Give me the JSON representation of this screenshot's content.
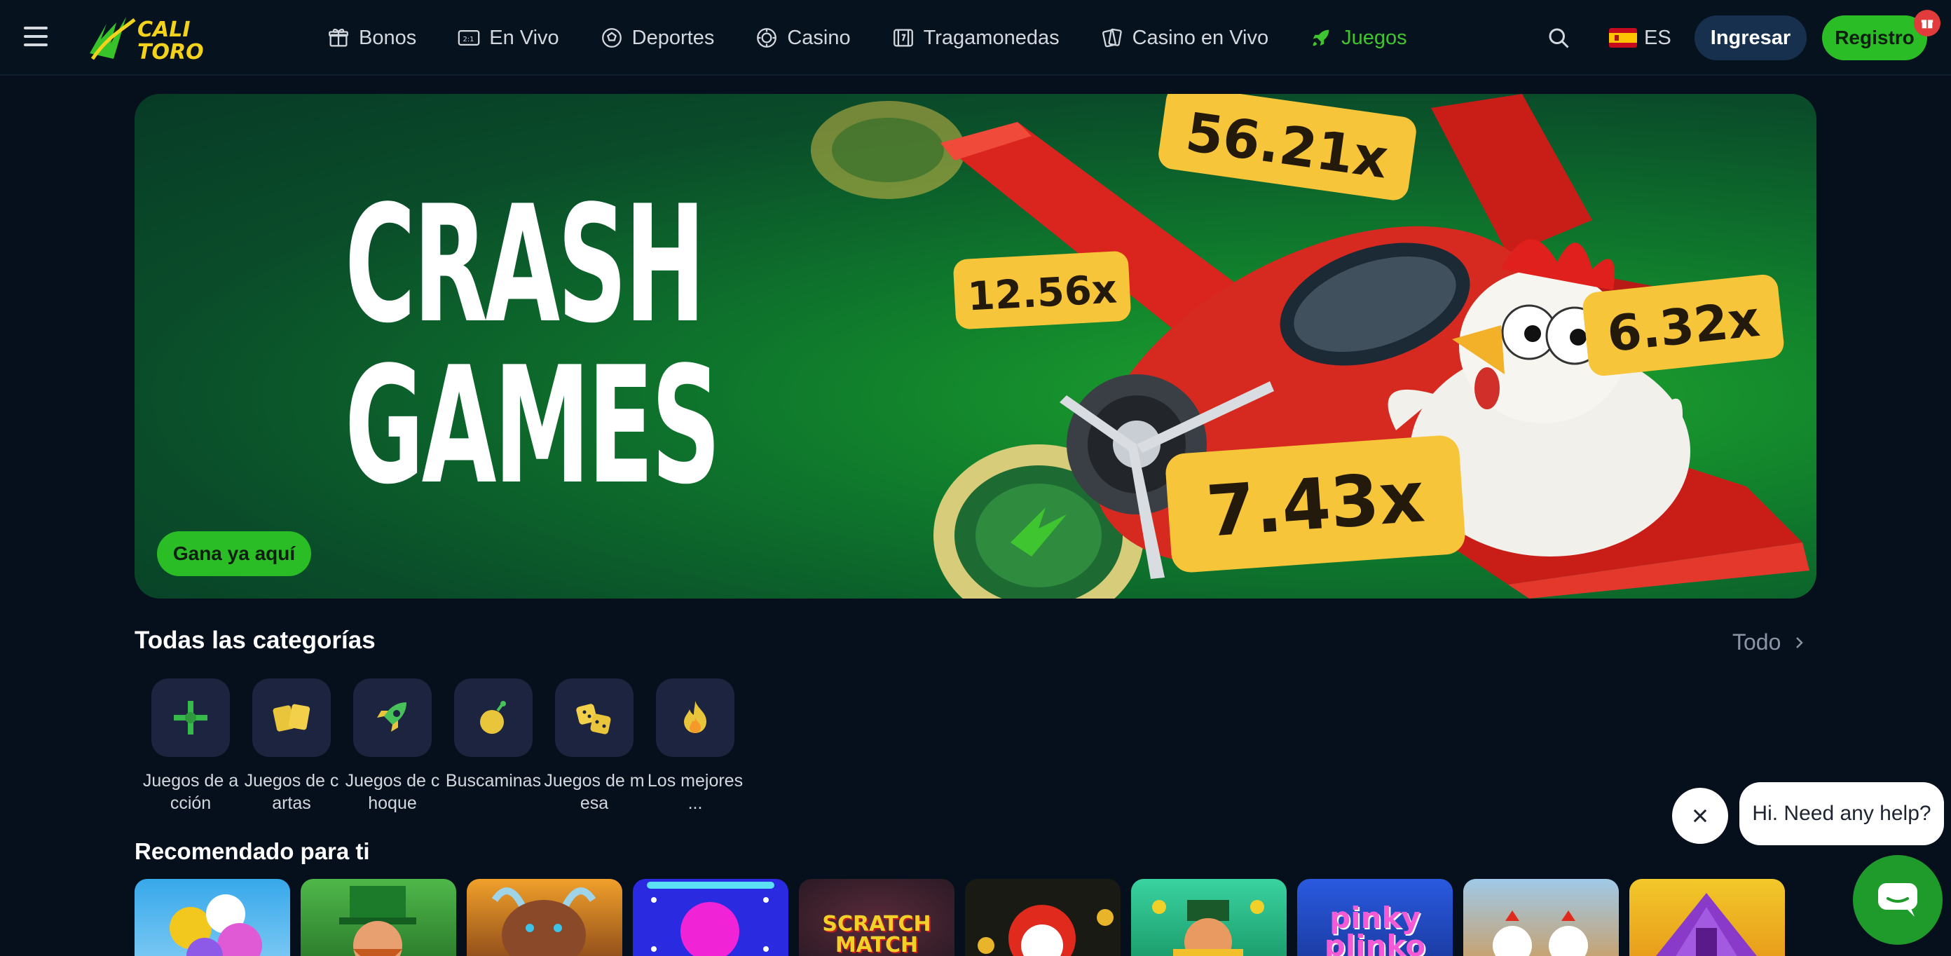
{
  "brand": {
    "line1": "CALI",
    "line2": "TORO"
  },
  "nav": {
    "items": [
      {
        "label": "Bonos",
        "icon": "gift-icon"
      },
      {
        "label": "En Vivo",
        "icon": "live-score-icon"
      },
      {
        "label": "Deportes",
        "icon": "soccer-ball-icon"
      },
      {
        "label": "Casino",
        "icon": "casino-chip-icon"
      },
      {
        "label": "Tragamonedas",
        "icon": "slot-machine-icon"
      },
      {
        "label": "Casino en Vivo",
        "icon": "playing-cards-icon"
      },
      {
        "label": "Juegos",
        "icon": "rocket-icon",
        "active": true
      }
    ]
  },
  "header": {
    "language": "ES",
    "login_label": "Ingresar",
    "register_label": "Registro"
  },
  "banner": {
    "title_line1": "CRASH",
    "title_line2": "GAMES",
    "cta_label": "Gana ya aquí",
    "multipliers": [
      "56.21x",
      "12.56x",
      "6.32x",
      "7.43x"
    ]
  },
  "categories": {
    "title": "Todas las categorías",
    "all_label": "Todo",
    "items": [
      {
        "label": "Juegos de acción",
        "icon": "crossed-swords-icon"
      },
      {
        "label": "Juegos de cartas",
        "icon": "cards-icon"
      },
      {
        "label": "Juegos de choque",
        "icon": "rocket-icon"
      },
      {
        "label": "Buscaminas",
        "icon": "bomb-icon"
      },
      {
        "label": "Juegos de mesa",
        "icon": "dice-icon"
      },
      {
        "label": "Los mejores ...",
        "icon": "flame-icon"
      }
    ]
  },
  "recommended": {
    "title": "Recomendado para ti",
    "games": [
      {
        "name": "balloons",
        "text": ""
      },
      {
        "name": "leprechaun",
        "text": ""
      },
      {
        "name": "buffalo",
        "text": ""
      },
      {
        "name": "plinko-ball",
        "text": ""
      },
      {
        "name": "scratch-match",
        "text": "SCRATCH MATCH"
      },
      {
        "name": "chicken-coins",
        "text": ""
      },
      {
        "name": "leprechaun-gold",
        "text": ""
      },
      {
        "name": "pinky-plinko",
        "text": "pinky plinko"
      },
      {
        "name": "chickens",
        "text": ""
      },
      {
        "name": "aztec-pyramid",
        "text": ""
      }
    ]
  },
  "chat": {
    "message": "Hi. Need any help?"
  }
}
